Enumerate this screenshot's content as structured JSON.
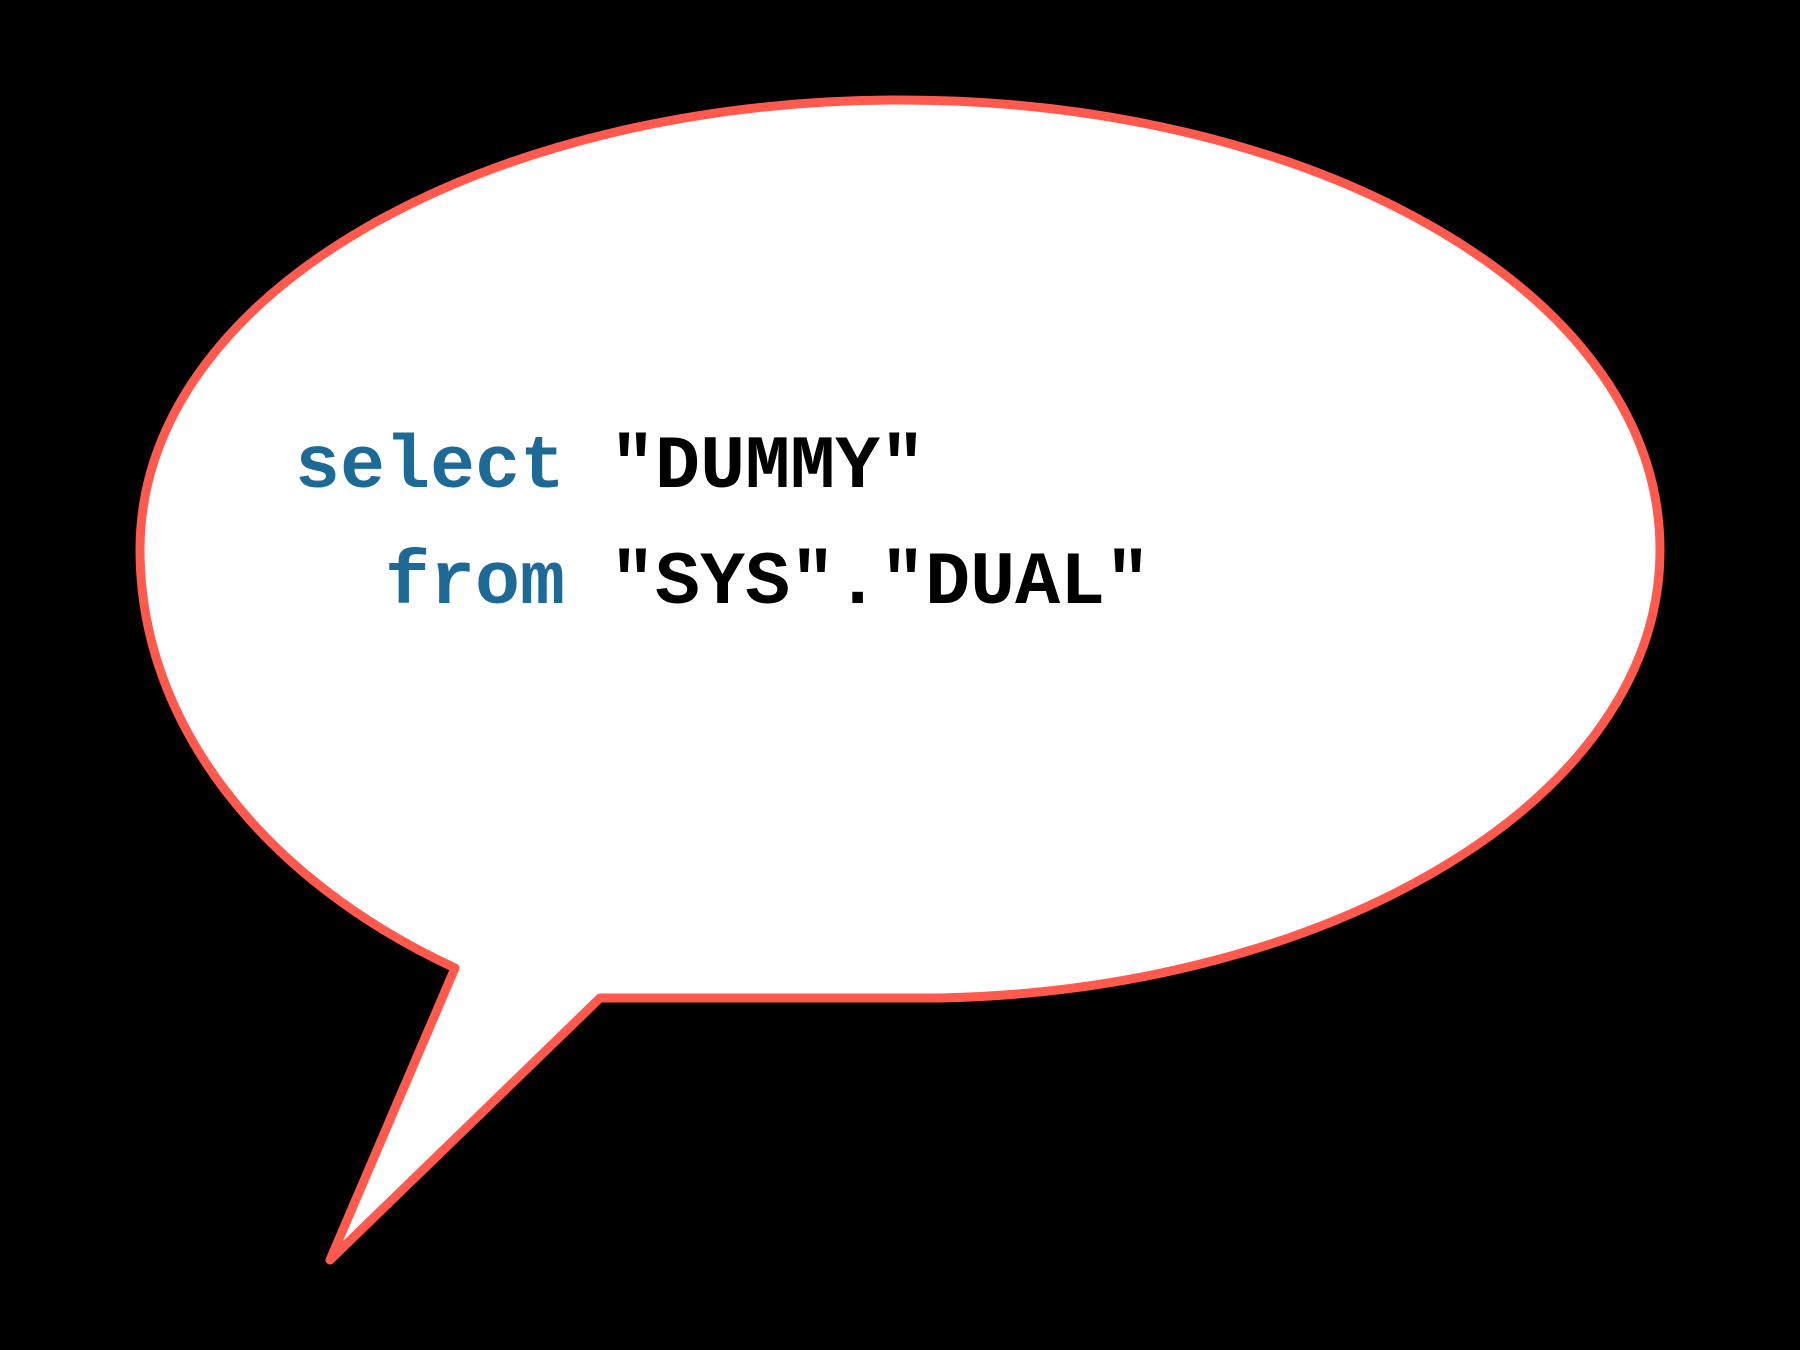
{
  "sql": {
    "line1_keyword": "select",
    "line1_rest": " \"DUMMY\"",
    "line2_indent": "  ",
    "line2_keyword": "from",
    "line2_rest": " \"SYS\".\"DUAL\""
  },
  "colors": {
    "stroke": "#ff5a4d",
    "fill": "#ffffff",
    "keyword": "#1e6a96",
    "text": "#000000",
    "background": "#000000"
  }
}
